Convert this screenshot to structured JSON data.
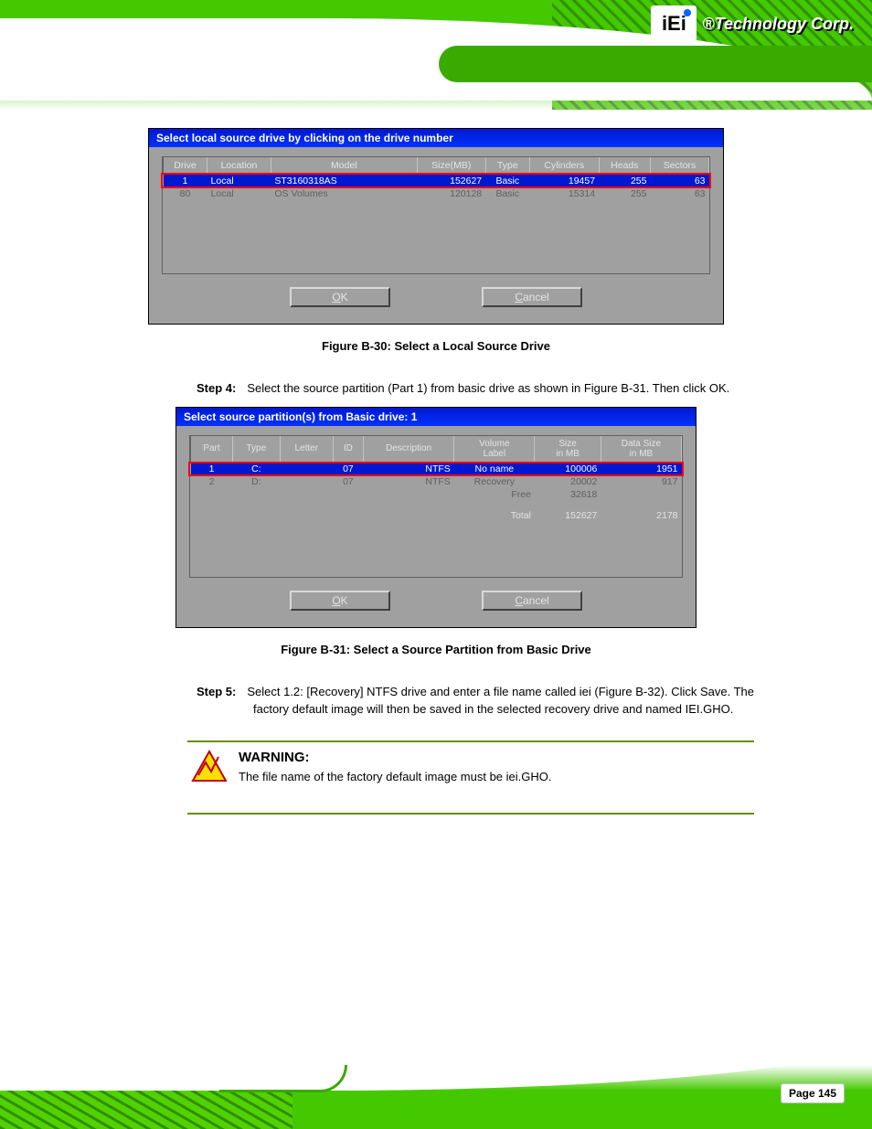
{
  "brand": {
    "logo_text": "iEi",
    "tagline": "®Technology Corp."
  },
  "dialog1": {
    "title": "Select local source drive by clicking on the drive number",
    "headers": [
      "Drive",
      "Location",
      "Model",
      "Size(MB)",
      "Type",
      "Cylinders",
      "Heads",
      "Sectors"
    ],
    "rows": [
      {
        "selected": true,
        "cells": [
          "1",
          "Local",
          "ST3160318AS",
          "152627",
          "Basic",
          "19457",
          "255",
          "63"
        ]
      },
      {
        "selected": false,
        "cells": [
          "80",
          "Local",
          "OS Volumes",
          "120128",
          "Basic",
          "15314",
          "255",
          "63"
        ]
      }
    ],
    "ok": "OK",
    "cancel": "Cancel"
  },
  "fig1": "Figure B-30: Select a Local Source Drive",
  "step4": {
    "label": "Step 4:",
    "text": "Select the source partition (Part 1) from basic drive as shown in Figure B-31. Then click OK."
  },
  "dialog2": {
    "title": "Select source partition(s) from Basic drive: 1",
    "headers_row1": [
      "",
      "",
      "",
      "",
      "",
      "Volume",
      "Size",
      "Data Size"
    ],
    "headers_row2": [
      "Part",
      "Type",
      "Letter",
      "ID",
      "Description",
      "Label",
      "in MB",
      "in MB"
    ],
    "rows": [
      {
        "selected": true,
        "cells": [
          "1",
          "C:",
          "",
          "07",
          "NTFS",
          "No name",
          "100006",
          "1951"
        ]
      },
      {
        "selected": false,
        "cells": [
          "2",
          "D:",
          "",
          "07",
          "NTFS",
          "Recovery",
          "20002",
          "917"
        ]
      }
    ],
    "free": {
      "label": "Free",
      "size": "32618",
      "data": ""
    },
    "total": {
      "label": "Total",
      "size": "152627",
      "data": "2178"
    },
    "ok": "OK",
    "cancel": "Cancel"
  },
  "fig2": "Figure B-31: Select a Source Partition from Basic Drive",
  "step5": {
    "label": "Step 5:",
    "text": "Select 1.2: [Recovery] NTFS drive and enter a file name called iei (Figure B-32). Click Save. The factory default image will then be saved in the selected recovery drive and named IEI.GHO."
  },
  "warning": {
    "title": "WARNING:",
    "body": "The file name of the factory default image must be iei.GHO."
  },
  "page": "Page 145"
}
